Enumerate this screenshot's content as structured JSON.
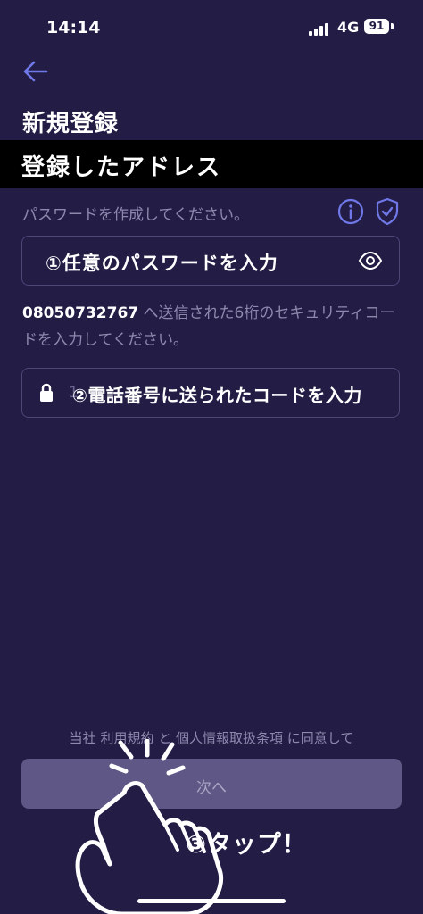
{
  "status_bar": {
    "time": "14:14",
    "network": "4G",
    "battery": "91"
  },
  "header": {
    "title": "新規登録"
  },
  "overlay": {
    "banner": "登録したアドレス",
    "step1": "①任意のパスワードを入力",
    "step2": "②電話番号に送られたコードを入力",
    "step3": "③タップ！"
  },
  "password": {
    "instruction": "パスワードを作成してください。"
  },
  "sms": {
    "phone": "08050732767",
    "instruction_rest": " へ送信された6桁のセキュリティコードを入力してください。",
    "code_partial": "1"
  },
  "consent": {
    "prefix": "当社 ",
    "terms_link": "利用規約",
    "middle": " と ",
    "privacy_link": "個人情報取扱条項",
    "suffix": " に同意して"
  },
  "next_button": {
    "label": "次へ"
  },
  "icons": {
    "back": "arrow-left-icon",
    "info": "info-icon",
    "shield": "shield-check-icon",
    "eye": "eye-icon",
    "lock": "lock-icon",
    "hand": "tapping-hand-icon"
  },
  "colors": {
    "background": "#231c45",
    "accent": "#6f78e6",
    "button": "#5f5785"
  }
}
